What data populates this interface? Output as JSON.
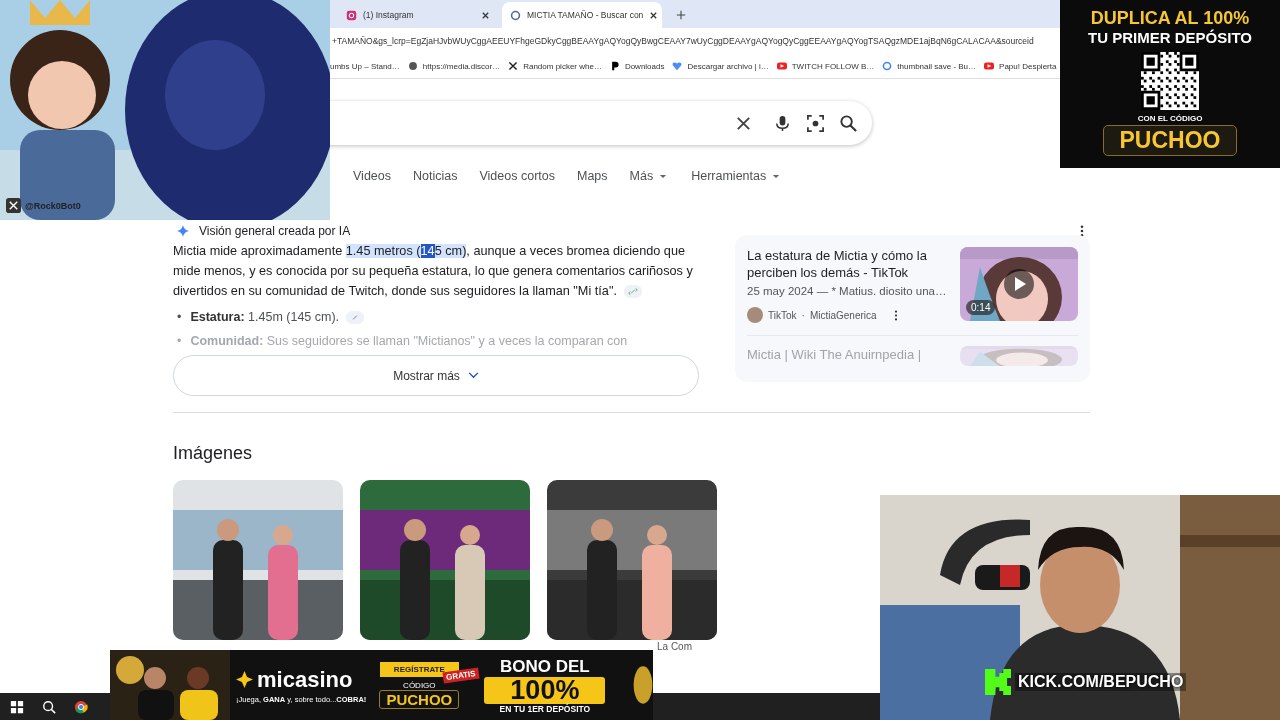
{
  "browser": {
    "tabs": [
      {
        "title": "(1) Instagram",
        "selected": false
      },
      {
        "title": "MICTIA TAMAÑO - Buscar con",
        "selected": true
      }
    ],
    "url": "+TAMAÑO&gs_lcrp=EgZjaHJvbWUyCggAEEUYFhgeGDkyCggBEAAYgAQYogQyBwgCEAAY7wUyCggDEAAYgAQYogQyCggEEAAYgAQYogTSAQgzMDE1ajBqN6gCALACAA&sourceid",
    "bookmarks": [
      "umbs Up – Stand…",
      "https://media.discor…",
      "Random picker whe…",
      "Downloads",
      "Descargar archivo | i…",
      "TWITCH FOLLOW B…",
      "thumbnail save - Bu…",
      "Papu! Despierta"
    ]
  },
  "nav_tabs": [
    {
      "label": "Videos",
      "kind": "tab"
    },
    {
      "label": "Noticias",
      "kind": "tab"
    },
    {
      "label": "Videos cortos",
      "kind": "tab"
    },
    {
      "label": "Maps",
      "kind": "tab"
    },
    {
      "label": "Más",
      "kind": "menu"
    },
    {
      "label": "Herramientas",
      "kind": "menu"
    }
  ],
  "ai_overview": {
    "heading": "Visión general creada por IA",
    "paragraph": [
      {
        "text": "Mictia mide aproximadamente ",
        "kind": "plain"
      },
      {
        "text": "1.45 metros (",
        "kind": "highlight"
      },
      {
        "text": "14",
        "kind": "selected"
      },
      {
        "text": "5 cm)",
        "kind": "highlight"
      },
      {
        "text": ", aunque a veces bromea diciendo que mide menos, y es conocida por su pequeña estatura, lo que genera comentarios cariñosos y divertidos en su comunidad de Twitch, donde sus seguidores la llaman \"Mi tía\".",
        "kind": "plain"
      }
    ],
    "marker": "•",
    "bullets": [
      {
        "label": "Estatura:",
        "text": "1.45m (145 cm).",
        "faded": false
      },
      {
        "label": "Comunidad:",
        "text": "Sus seguidores se llaman \"Mictianos\" y a veces la comparan con",
        "faded": true
      }
    ],
    "show_more": "Mostrar más",
    "sources": [
      {
        "title": "La estatura de Mictia y cómo la perciben los demás - TikTok",
        "snippet": "25 may 2024 — * Matius. diosito una…",
        "site": "TikTok",
        "separator": "·",
        "author": "MictiaGenerica",
        "duration": "0:14",
        "faded": false
      },
      {
        "title": "Mictia | Wiki The Anuirnpedia |",
        "faded": true
      }
    ]
  },
  "images": {
    "heading": "Imágenes",
    "caption": "La Com"
  },
  "overlays": {
    "handle": "@Rock0Bot0",
    "top_ad": {
      "line1": "DUPLICA AL 100%",
      "line2": "TU PRIMER DEPÓSITO",
      "code_label": "CON EL CÓDIGO",
      "code": "PUCHOO"
    },
    "casino": {
      "logo": "micasino",
      "slogan": "¡Juega, **GANA** y, sobre todo...**COBRA!**",
      "register": "REGÍSTRATE",
      "free": "GRATIS",
      "code_label": "CÓDIGO",
      "code": "PUCHOO",
      "bonus1": "BONO DEL",
      "bonus2": "100%",
      "bonus3": "EN TU 1ER DEPÓSITO"
    },
    "channel": "KICK.COM/BEPUCHO"
  }
}
